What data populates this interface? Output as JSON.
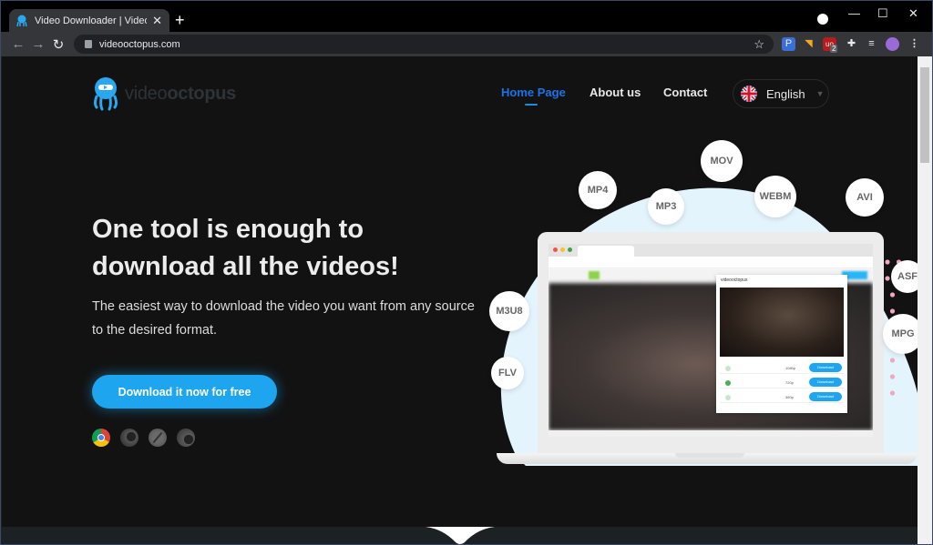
{
  "browser": {
    "tab_title": "Video Downloader | Video Octopus",
    "new_tab_label": "+",
    "close_tab_label": "✕",
    "url": "videooctopus.com",
    "window_controls": {
      "minimize": "—",
      "maximize": "☐",
      "close": "✕"
    },
    "extensions": [
      {
        "name": "search-extension",
        "glyph": "P",
        "color": "#3b6fd8"
      },
      {
        "name": "rss-extension",
        "glyph": "◥",
        "color": "#f5a623"
      },
      {
        "name": "ublock-extension",
        "glyph": "uo",
        "color": "#b71c1c",
        "badge": "2"
      },
      {
        "name": "extensions-puzzle",
        "glyph": "✚",
        "color": "#e8eaed"
      },
      {
        "name": "media-control",
        "glyph": "≡♪",
        "color": "#e8eaed"
      }
    ]
  },
  "site": {
    "logo": {
      "light": "video",
      "bold": "octopus"
    },
    "nav": [
      {
        "label": "Home Page",
        "active": true
      },
      {
        "label": "About us",
        "active": false
      },
      {
        "label": "Contact",
        "active": false
      }
    ],
    "language": "English",
    "hero": {
      "title": "One tool is enough to download all the videos!",
      "subtitle": "The easiest way to download the video you want from any source to the desired format.",
      "cta": "Download it now for free"
    },
    "browsers": [
      "chrome",
      "firefox",
      "safari",
      "edge"
    ],
    "formats": [
      "MOV",
      "MP4",
      "MP3",
      "WEBM",
      "AVI",
      "ASF",
      "M3U8",
      "MPG",
      "FLV"
    ],
    "mockup": {
      "popup_logo": "videooctopus",
      "download_label": "Download",
      "rows": [
        {
          "quality": "1080p"
        },
        {
          "quality": "720p"
        },
        {
          "quality": "360p"
        }
      ]
    },
    "colors": {
      "accent": "#1ea5f0",
      "nav_active": "#1a73e8",
      "background": "#121212",
      "blob": "#e3f4fd",
      "dots": "#f3a6bf"
    }
  }
}
